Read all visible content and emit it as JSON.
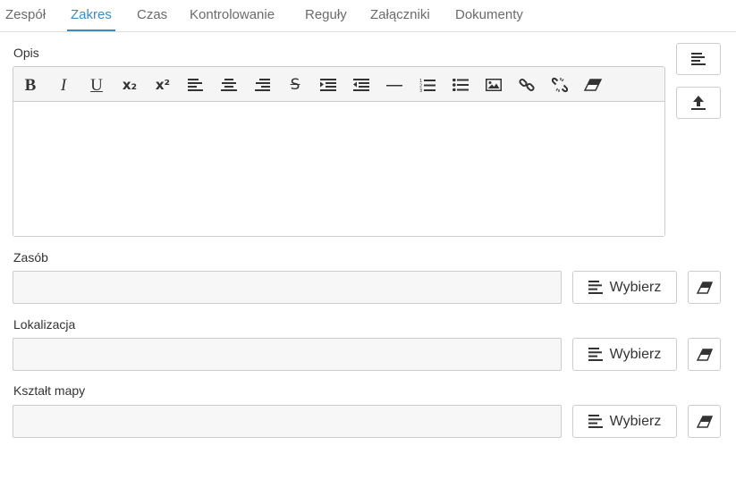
{
  "tabs": [
    {
      "label": "Zespół",
      "active": false
    },
    {
      "label": "Zakres",
      "active": true
    },
    {
      "label": "Czas",
      "active": false
    },
    {
      "label": "Kontrolowanie",
      "active": false
    },
    {
      "label": "Reguły",
      "active": false
    },
    {
      "label": "Załączniki",
      "active": false
    },
    {
      "label": "Dokumenty",
      "active": false
    }
  ],
  "description": {
    "label": "Opis",
    "value": "",
    "toolbar": {
      "bold": "B",
      "italic": "I",
      "underline": "U",
      "subscript": "x₂",
      "superscript": "x²",
      "strikethrough": "S"
    }
  },
  "fields": [
    {
      "label": "Zasób",
      "value": "",
      "button_label": "Wybierz"
    },
    {
      "label": "Lokalizacja",
      "value": "",
      "button_label": "Wybierz"
    },
    {
      "label": "Kształt mapy",
      "value": "",
      "button_label": "Wybierz"
    }
  ],
  "icons": {
    "choose": "list-icon",
    "clear": "eraser-icon",
    "template": "list-icon",
    "upload": "upload-icon"
  },
  "colors": {
    "accent": "#3c8dbc",
    "tab_text": "#6b6b6b",
    "input_background": "#f7f7f7",
    "border": "#cccccc"
  }
}
